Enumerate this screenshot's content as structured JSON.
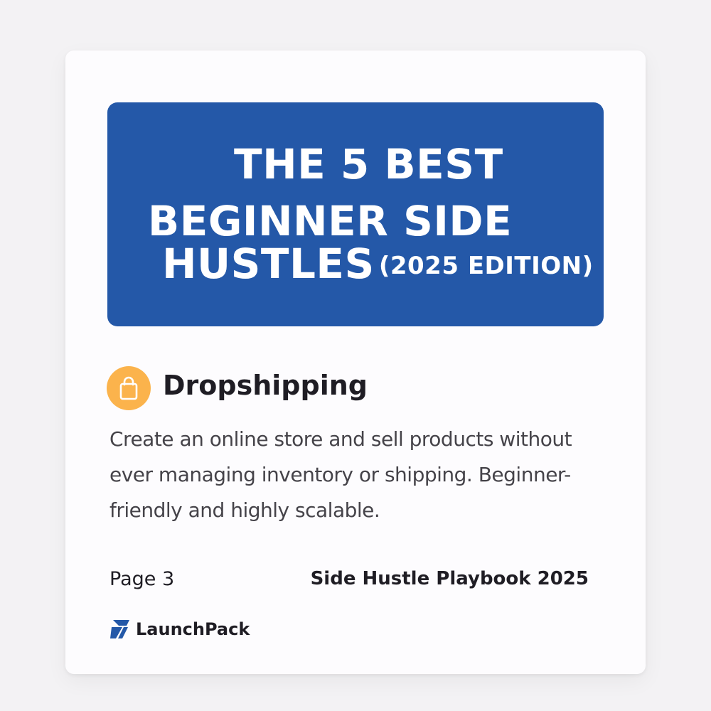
{
  "banner": {
    "line1": "THE 5 BEST",
    "line2": "BEGINNER SIDE",
    "line3": "HUSTLES",
    "edition": "(2025 EDITION)"
  },
  "section": {
    "icon": "shopping-bag-icon",
    "title": "Dropshipping",
    "body": "Create an online store and sell products without ever managing inventory or shipping. Beginner-friendly and highly scalable."
  },
  "footer": {
    "page": "Page 3",
    "book_title": "Side Hustle Playbook 2025"
  },
  "brand": {
    "icon": "launchpack-logo-icon",
    "name": "LaunchPack"
  },
  "colors": {
    "banner": "#2458a8",
    "icon_circle": "#fbb34c",
    "logo": "#2458a8"
  }
}
